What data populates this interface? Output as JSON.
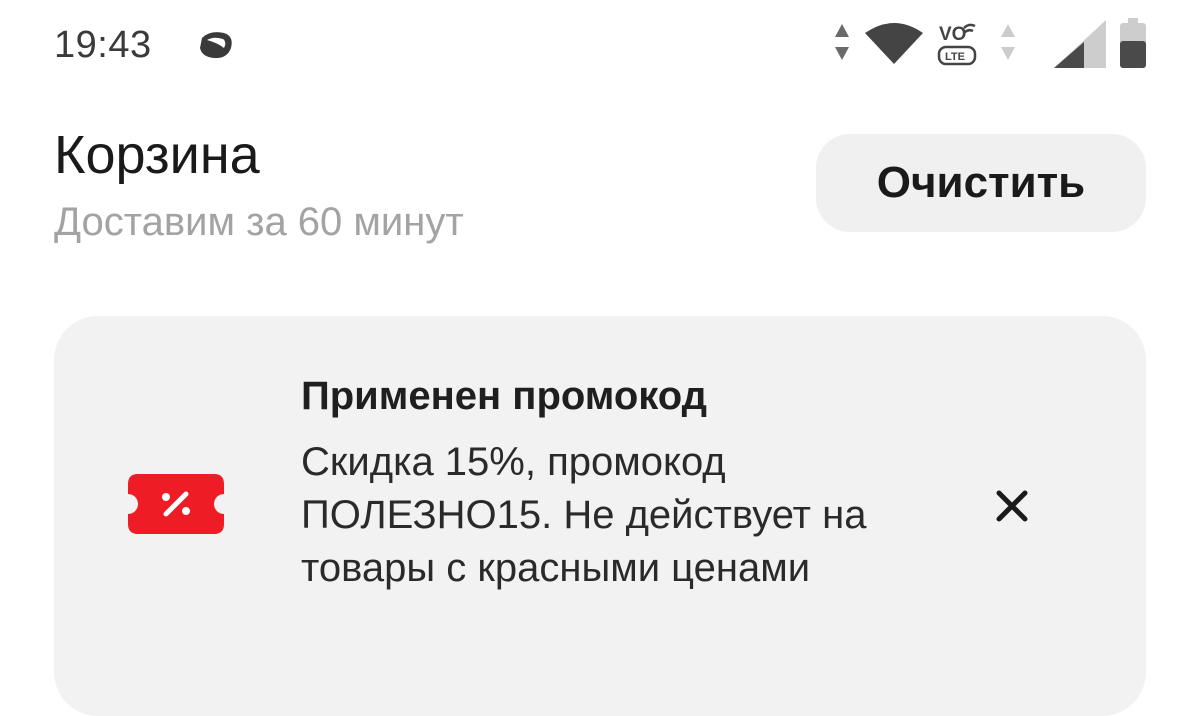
{
  "status_bar": {
    "time": "19:43",
    "icons": [
      "app-notification-icon",
      "data-arrows-icon",
      "wifi-icon",
      "volte-icon",
      "signal-icon",
      "battery-icon"
    ],
    "volte_top": "VO",
    "volte_bottom": "LTE"
  },
  "header": {
    "title": "Корзина",
    "subtitle": "Доставим за 60 минут",
    "clear_label": "Очистить"
  },
  "promo": {
    "icon": "discount-ticket-icon",
    "title": "Применен промокод",
    "description": "Скидка 15%, промокод ПОЛЕЗНО15. Не действует на товары с красными ценами",
    "close_icon": "close-icon"
  },
  "colors": {
    "accent_red": "#ee1c25",
    "card_bg": "#f2f2f2",
    "button_bg": "#f0f0f0",
    "subtitle_gray": "#a3a3a3"
  }
}
